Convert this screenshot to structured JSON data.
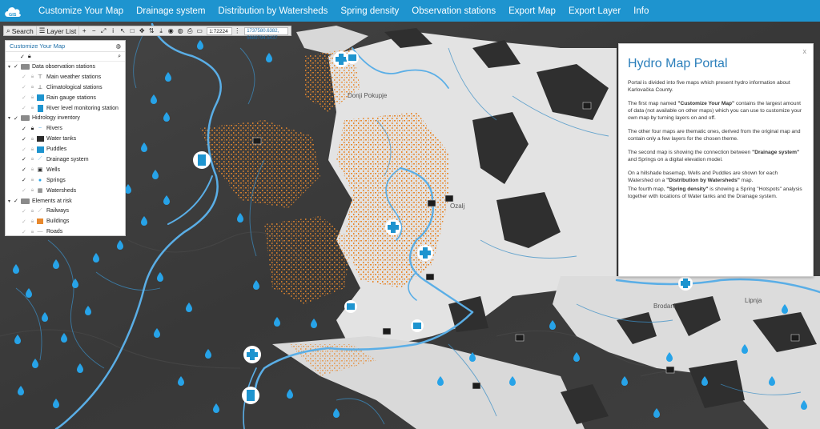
{
  "nav": {
    "logo": "GIS",
    "items": [
      "Customize Your Map",
      "Drainage system",
      "Distribution by Watersheds",
      "Spring density",
      "Observation stations",
      "Export Map",
      "Export Layer",
      "Info"
    ]
  },
  "toolbar": {
    "search_label": "Search",
    "layer_list_label": "Layer List",
    "scale": "1:72224",
    "coords": "1737580.6382, 5689794.5437"
  },
  "layer_panel": {
    "title": "Customize Your Map",
    "groups": [
      {
        "label": "Data observation stations",
        "checked": true,
        "items": [
          {
            "label": "Main weather stations",
            "checked": false,
            "icon": "weather-station-icon"
          },
          {
            "label": "Climatological stations",
            "checked": false,
            "icon": "climate-station-icon"
          },
          {
            "label": "Rain gauge stations",
            "checked": false,
            "icon": "rain-gauge-icon"
          },
          {
            "label": "River level monitoring station",
            "checked": false,
            "icon": "river-level-icon"
          }
        ]
      },
      {
        "label": "Hidrology inventory",
        "checked": true,
        "items": [
          {
            "label": "Rivers",
            "checked": true,
            "icon": "river-icon"
          },
          {
            "label": "Water tanks",
            "checked": true,
            "icon": "water-tank-icon"
          },
          {
            "label": "Puddles",
            "checked": false,
            "icon": "puddle-icon"
          },
          {
            "label": "Drainage system",
            "checked": true,
            "icon": "drainage-icon"
          },
          {
            "label": "Wells",
            "checked": true,
            "icon": "well-icon"
          },
          {
            "label": "Springs",
            "checked": true,
            "icon": "spring-icon"
          },
          {
            "label": "Watersheds",
            "checked": false,
            "icon": "watershed-icon"
          }
        ]
      },
      {
        "label": "Elements at risk",
        "checked": true,
        "items": [
          {
            "label": "Railways",
            "checked": false,
            "icon": "railway-icon"
          },
          {
            "label": "Buildings",
            "checked": false,
            "icon": "building-icon"
          },
          {
            "label": "Roads",
            "checked": false,
            "icon": "road-icon"
          }
        ]
      }
    ]
  },
  "info": {
    "title": "Hydro Map Portal",
    "close": "x",
    "p1": "Portal is divided into five maps which present hydro information about Karlovačka County.",
    "p2_pre": "The first map named ",
    "p2_bold": "\"Customize Your Map\"",
    "p2_post": " contains the largest amount of data (not available on other maps) which you can use to customize your own map by turning layers on and off.",
    "p3": "The other four maps are thematic ones, derived from the original map and contain only a few layers for the chosen theme.",
    "p4_pre": "The second map is showing the connection between ",
    "p4_bold": "\"Drainage system\"",
    "p4_post": " and Springs on a digital elevation model.",
    "p5_pre": "On a hillshade basemap, Wells and Puddles are shown for each Watershed on a ",
    "p5_bold": "\"Distribution by Watersheds\"",
    "p5_post": " map.",
    "p6_pre": "The fourth map, ",
    "p6_bold": "\"Spring density\"",
    "p6_post": " is showing a Spring \"Hotspots\" analysis together with locations of Water tanks and the Drainage system."
  },
  "map_labels": {
    "town1": "Donji Pokupje",
    "town2": "Ozalj",
    "town3": "Brodani",
    "town4": "Lipnja"
  },
  "colors": {
    "nav": "#1e94cf",
    "river": "#5aaee6",
    "terrain": "#3b3b3b",
    "urban": "#e6e6e6",
    "buildings": "#e8892e",
    "spring": "#27a3e8"
  }
}
